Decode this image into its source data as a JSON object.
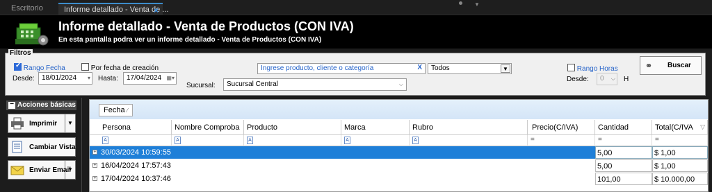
{
  "tabs": [
    {
      "label": "Escritorio"
    },
    {
      "label": "Informe detallado - Venta de ...",
      "close": "×"
    }
  ],
  "header": {
    "title": "Informe detallado - Venta de Productos (CON IVA)",
    "subtitle": "En esta pantalla podra ver un informe detallado - Venta de Productos (CON IVA)",
    "icon": "cash-register-icon"
  },
  "filters": {
    "legend": "Filtros",
    "rango_fecha_label": "Rango Fecha",
    "rango_fecha_checked": true,
    "por_fecha_creacion_label": "Por fecha de creación",
    "por_fecha_creacion_checked": false,
    "desde_label": "Desde:",
    "desde_value": "18/01/2024",
    "hasta_label": "Hasta:",
    "hasta_value": "17/04/2024",
    "search_value": "Ingrese producto, cliente o categoría",
    "todos_value": "Todos",
    "sucursal_label": "Sucursal:",
    "sucursal_value": "Sucursal Central",
    "rango_horas_label": "Rango Horas",
    "rango_horas_checked": false,
    "horas_desde_label": "Desde:",
    "horas_desde_value": "0",
    "horas_h_label": "H",
    "buscar_label": "Buscar"
  },
  "acciones": {
    "title": "Acciones básicas",
    "imprimir": "Imprimir",
    "cambiar_vista": "Cambiar Vista",
    "enviar_email": "Enviar Email"
  },
  "grid": {
    "group_by": "Fecha",
    "columns": [
      "Persona",
      "Nombre Comproba",
      "Producto",
      "Marca",
      "Rubro",
      "Precio(C/IVA)",
      "Cantidad",
      "Total(C/IVA"
    ],
    "rows": [
      {
        "fecha": "30/03/2024 10:59:55",
        "cantidad": "5,00",
        "total": "$ 1,00",
        "selected": true
      },
      {
        "fecha": "16/04/2024 17:57:43",
        "cantidad": "5,00",
        "total": "$ 1,00",
        "selected": false
      },
      {
        "fecha": "17/04/2024 10:37:46",
        "cantidad": "101,00",
        "total": "$ 10.000,00",
        "selected": false
      }
    ]
  },
  "colors": {
    "selected_row": "#1e7fd8",
    "checkbox_blue": "#2d6ad8",
    "tab_accent": "#3c8ccb"
  }
}
